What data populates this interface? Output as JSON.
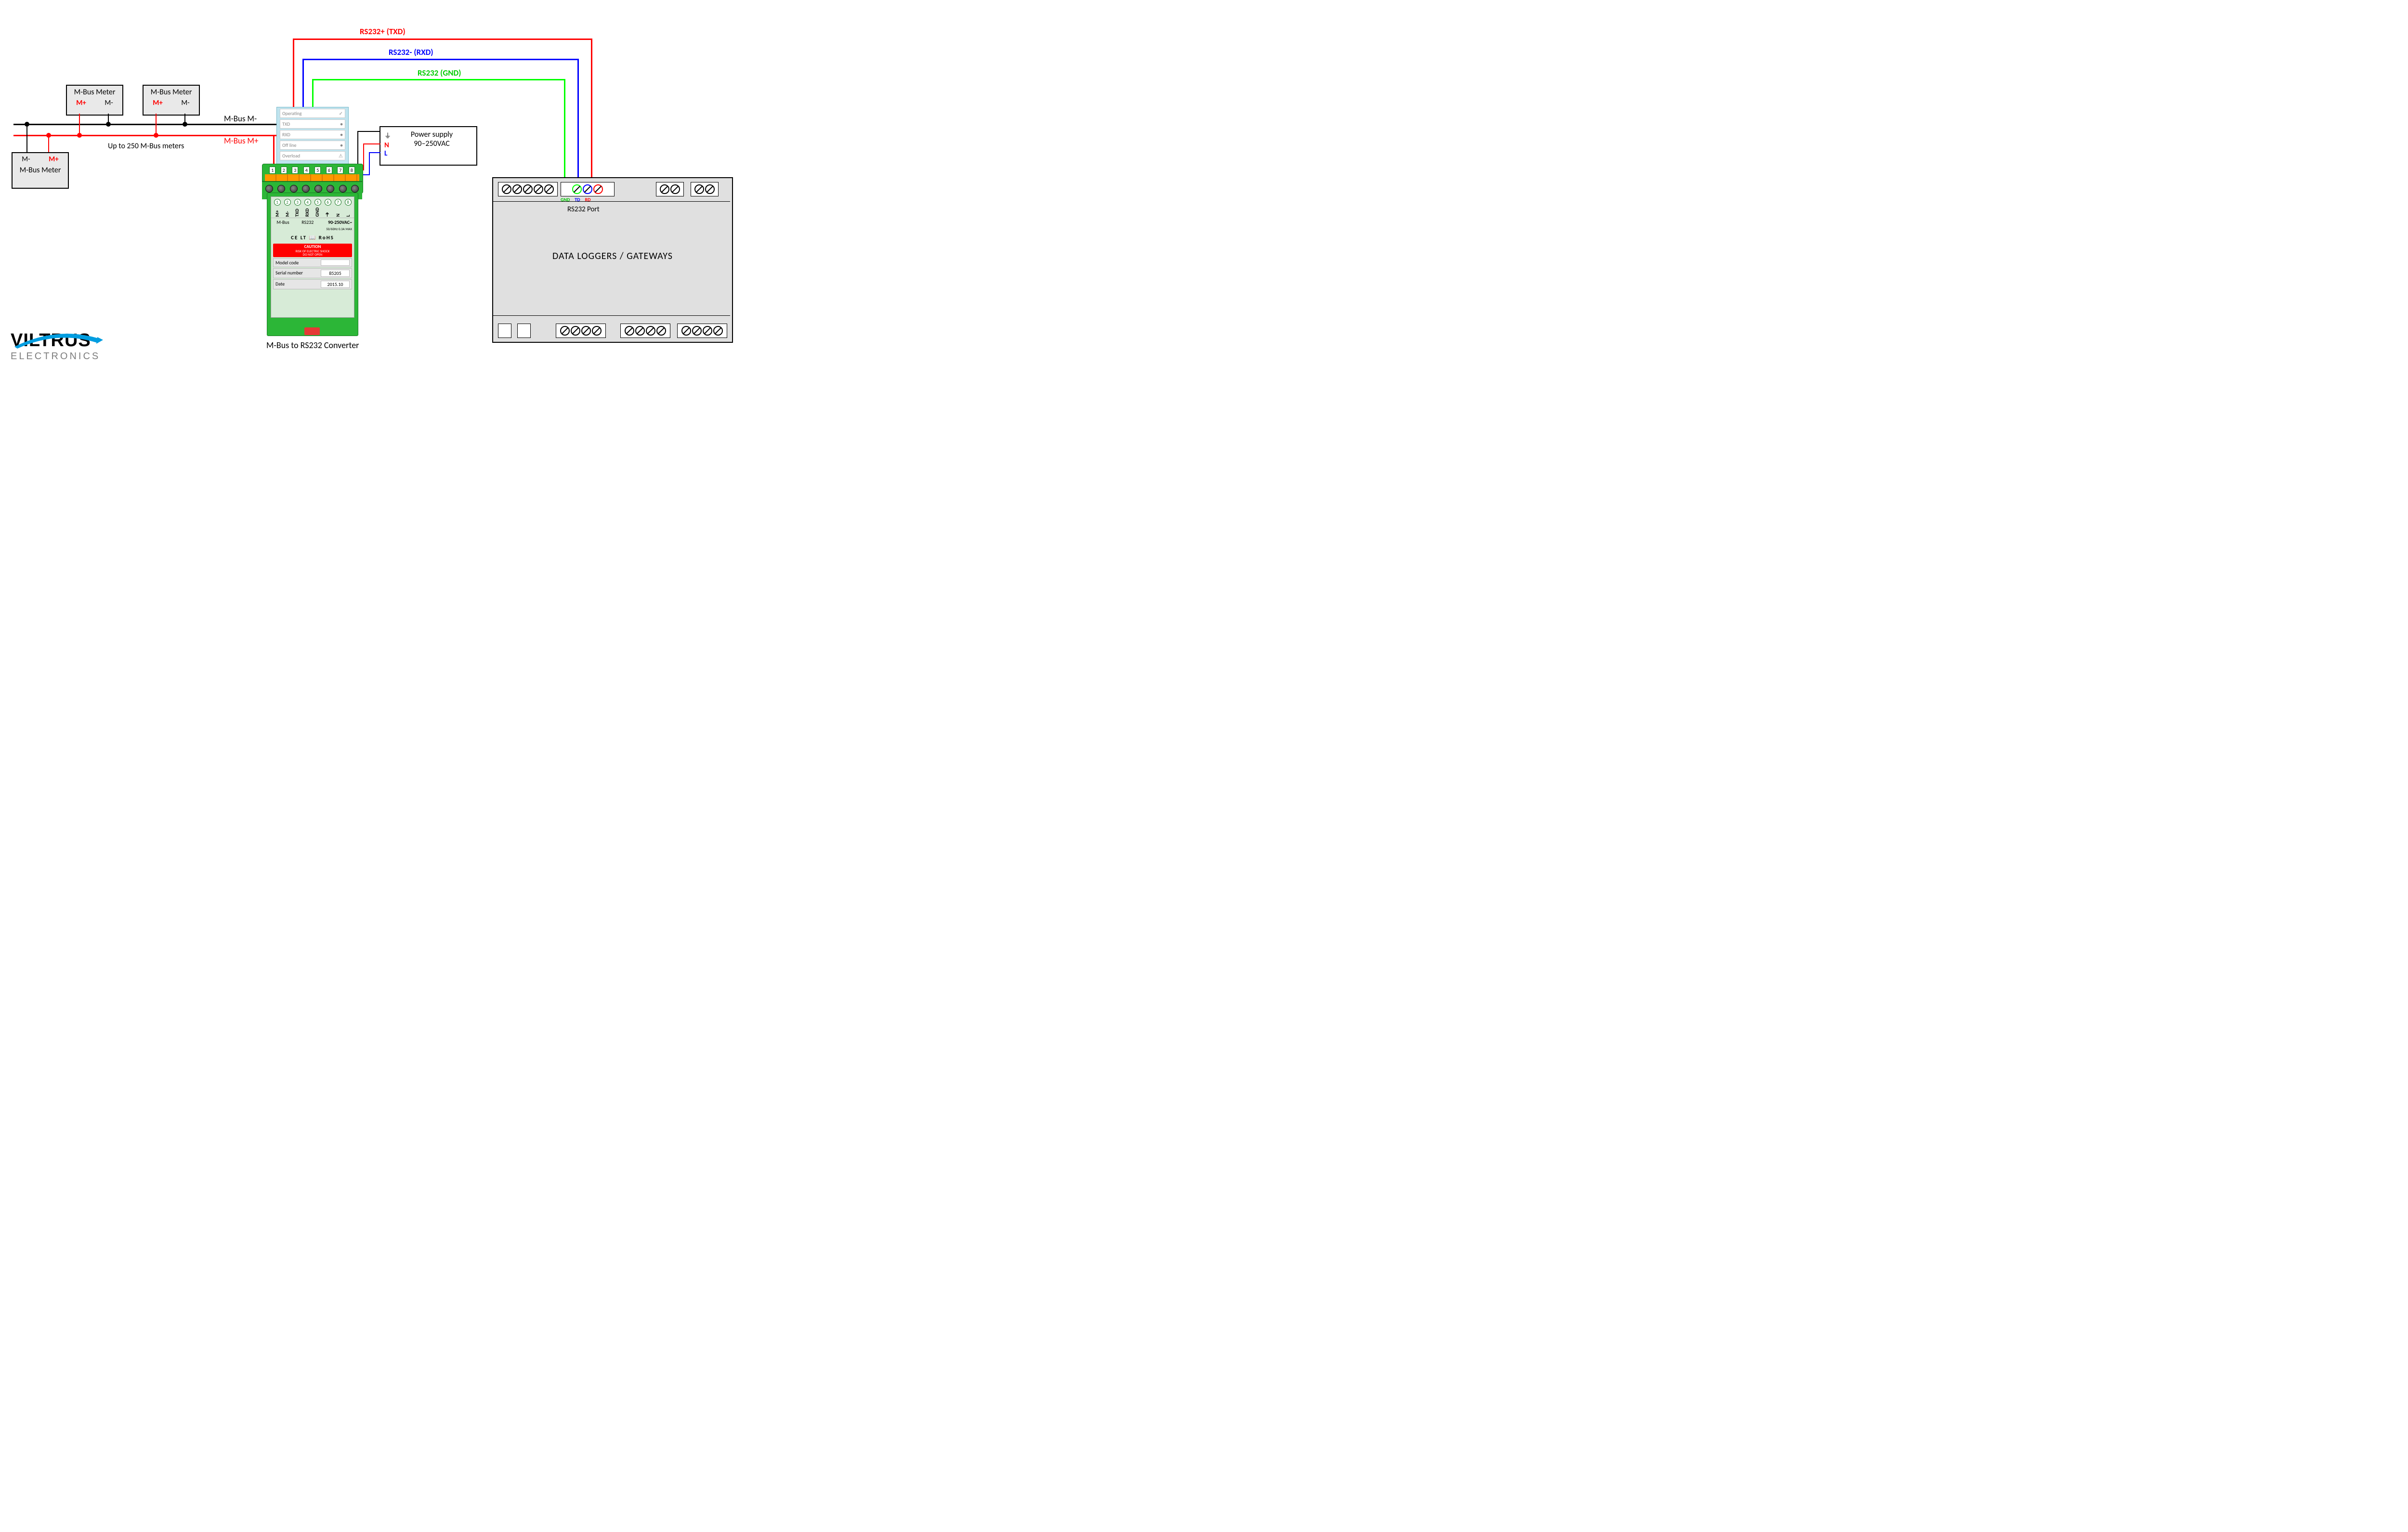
{
  "labels": {
    "rs232_txd": "RS232+ (TXD)",
    "rs232_rxd": "RS232-  (RXD)",
    "rs232_gnd": "RS232 (GND)",
    "mbus_m_minus": "M-Bus M-",
    "mbus_m_plus": "M-Bus M+",
    "upto": "Up to 250 M-Bus meters",
    "converter_title": "M-Bus to RS232 Converter",
    "rs232_port": "RS232 Port",
    "dataloggers": "DATA LOGGERS / GATEWAYS",
    "power_line1": "Power supply",
    "power_line2": "90–250VAC",
    "ps_N": "N",
    "ps_L": "L",
    "gnd": "GND",
    "td": "TD",
    "rd": "RD"
  },
  "mbus_meter": {
    "title": "M-Bus Meter",
    "m_plus": "M+",
    "m_minus": "M-"
  },
  "converter_face": {
    "section_mbus": "M-Bus",
    "section_rs232": "RS232",
    "section_power": "90-250VAC~",
    "section_power_sub": "50/60Hz 0.3A MAX",
    "terms": [
      "M+",
      "M-",
      "TXD",
      "RXD",
      "GND",
      "⏚",
      "N",
      "L"
    ],
    "term_nums": [
      "1",
      "2",
      "3",
      "4",
      "5",
      "6",
      "7",
      "8"
    ],
    "caution_title": "CAUTION",
    "caution_body": "RISK OF ELECTRIC SHOCK\nDO NOT OPEN",
    "icons": "CE  LT  📖  RoHS",
    "model_label": "Model code",
    "model_value": "",
    "serial_label": "Serial number",
    "serial_value": "85205",
    "date_label": "Date",
    "date_value": "2015.10",
    "top_operating": "Operating",
    "top_txd": "TXD",
    "top_rxd": "RXD",
    "top_offline": "Off line",
    "top_overload": "Overload"
  },
  "logo": {
    "line1": "VILTRUS",
    "line2": "ELECTRONICS"
  },
  "colors": {
    "red": "#ff0000",
    "blue": "#0000ff",
    "green": "#00ff00",
    "black": "#000000"
  }
}
